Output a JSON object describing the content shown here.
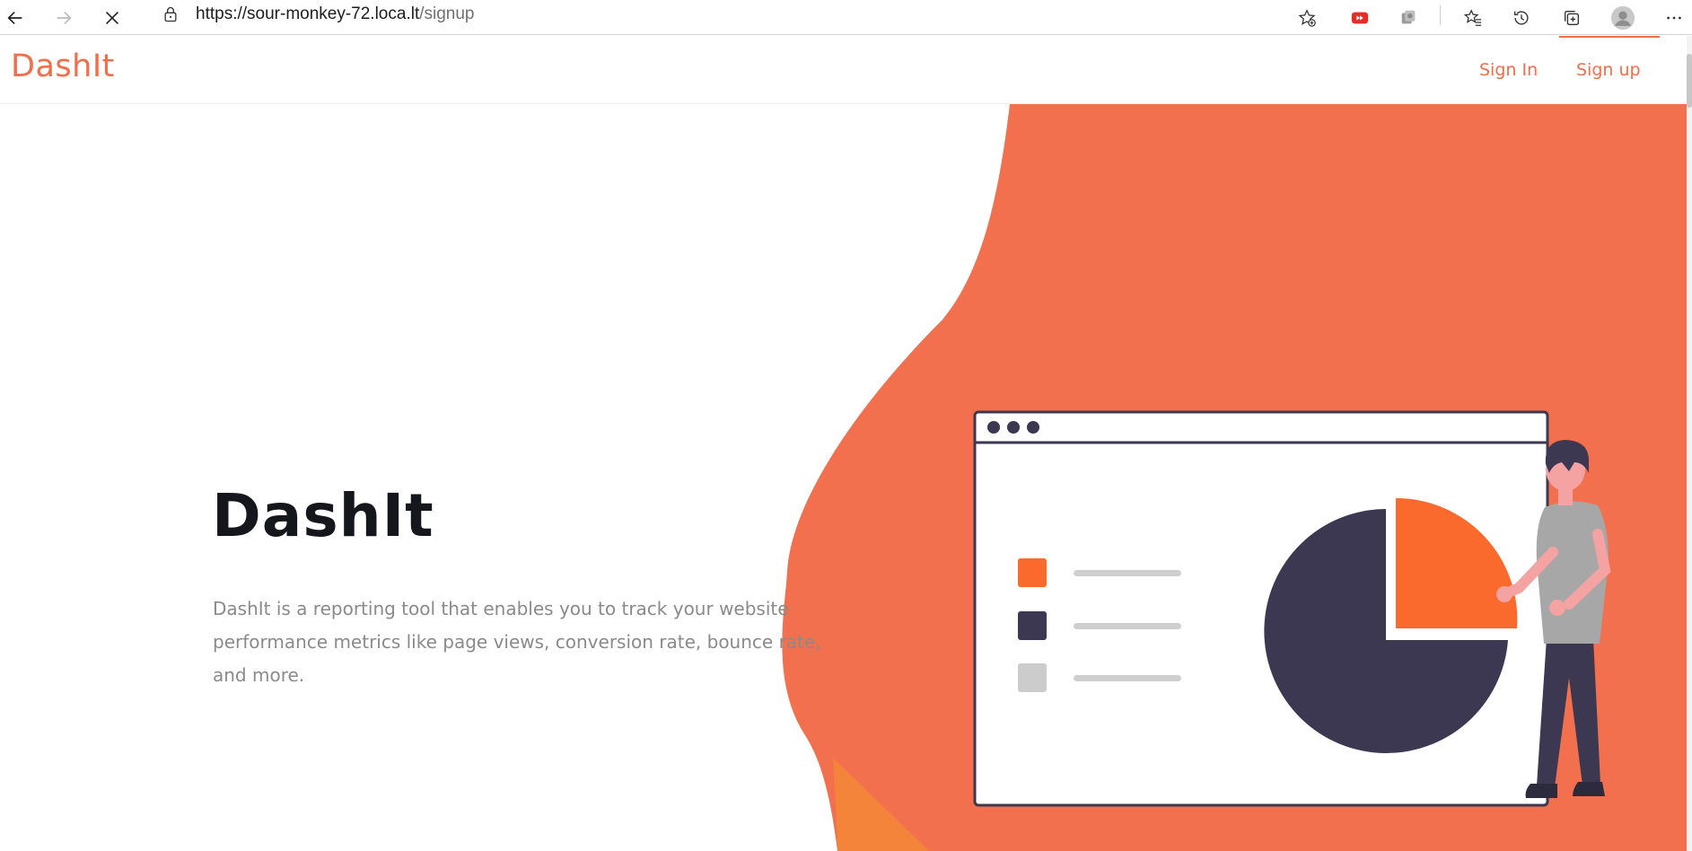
{
  "browser": {
    "url_host": "https://sour-monkey-72.loca.lt",
    "url_path": "/signup",
    "icons": [
      "back-icon",
      "forward-icon",
      "stop-loading-icon",
      "lock-icon",
      "add-favorite-icon",
      "youtube-extension-icon",
      "extension-icon",
      "favorites-icon",
      "history-icon",
      "collections-icon",
      "profile-avatar-icon",
      "more-menu-icon"
    ]
  },
  "navbar": {
    "brand": "DashIt",
    "links": [
      {
        "label": "Sign In"
      },
      {
        "label": "Sign up",
        "active": true
      }
    ]
  },
  "hero": {
    "title": "DashIt",
    "description": "DashIt is a reporting tool that enables you to track your website performance metrics like page views, conversion rate, bounce rate, and more."
  },
  "colors": {
    "accent": "#f26d4a",
    "pie_orange": "#f96a2c",
    "dark": "#3c3851",
    "title": "#16161d",
    "description": "#8a8a8a"
  }
}
